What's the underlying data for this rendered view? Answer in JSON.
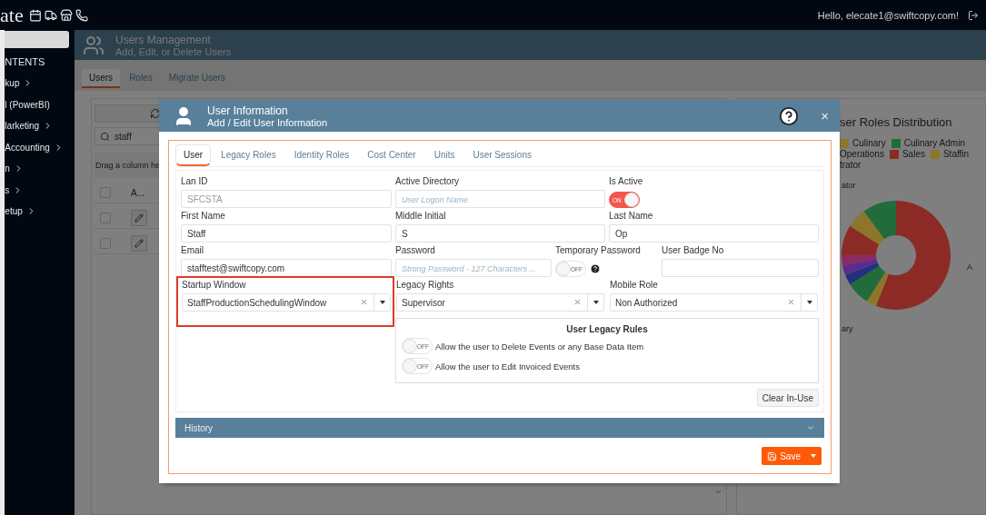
{
  "topbar": {
    "logo": "ate",
    "greeting": "Hello, elecate1@swiftcopy.com!"
  },
  "sidebar": {
    "section": "NTENTS",
    "items": [
      {
        "label": "kup",
        "expandable": true
      },
      {
        "label": "l (PowerBI)",
        "expandable": false
      },
      {
        "label": "larketing",
        "expandable": true
      },
      {
        "label": "Accounting",
        "expandable": true
      },
      {
        "label": "n",
        "expandable": true
      },
      {
        "label": "s",
        "expandable": true
      },
      {
        "label": "etup",
        "expandable": true
      }
    ]
  },
  "page_header": {
    "title": "Users Management",
    "subtitle": "Add, Edit, or Delete Users"
  },
  "tabs": [
    {
      "label": "Users",
      "selected": true
    },
    {
      "label": "Roles",
      "selected": false
    },
    {
      "label": "Migrate Users",
      "selected": false
    }
  ],
  "grid": {
    "search": "staff",
    "group_hint": "Drag a column he",
    "header_checked": false,
    "columns": [
      "A..."
    ],
    "rows": [
      {
        "checked": false
      },
      {
        "checked": false
      }
    ]
  },
  "chart_panel": {
    "title": "ser Roles Distribution",
    "legend": [
      {
        "label": "Culinary",
        "color": "#8c7629"
      },
      {
        "label": "Culinary Admin",
        "color": "#226b3a"
      },
      {
        "label": "Operations"
      },
      {
        "label": "Sales",
        "color": "#8c2b26"
      },
      {
        "label": "Staffin",
        "color": "#8c7629"
      },
      {
        "label": "trator"
      }
    ],
    "slice_labels": [
      "ator",
      "ary",
      "A"
    ]
  },
  "modal": {
    "title": "User Information",
    "subtitle": "Add / Edit User Information",
    "close": "×",
    "tabs": [
      {
        "label": "User",
        "selected": true
      },
      {
        "label": "Legacy Roles",
        "selected": false
      },
      {
        "label": "Identity Roles",
        "selected": false
      },
      {
        "label": "Cost Center",
        "selected": false
      },
      {
        "label": "Units",
        "selected": false
      },
      {
        "label": "User Sessions",
        "selected": false
      }
    ],
    "rows": [
      [
        {
          "kind": "text",
          "label": "Lan ID",
          "value": "SFCSTA",
          "disabled": true
        },
        {
          "kind": "text",
          "label": "Active Directory",
          "placeholder": "User Logon Name"
        },
        {
          "kind": "toggle",
          "label": "Is Active",
          "on": true,
          "text": "ON"
        }
      ],
      [
        {
          "kind": "text",
          "label": "First Name",
          "value": "Staff"
        },
        {
          "kind": "text",
          "label": "Middle Initial",
          "value": "S"
        },
        {
          "kind": "text",
          "label": "Last Name",
          "value": "Op"
        }
      ],
      [
        {
          "kind": "text",
          "label": "Email",
          "value": "stafftest@swiftcopy.com"
        },
        {
          "kind": "group",
          "items": [
            {
              "kind": "text",
              "label": "Password",
              "placeholder": "Strong Password - 127 Characters ..."
            },
            {
              "kind": "toggle",
              "label": "Temporary Password",
              "on": false,
              "text": "OFF",
              "help": true
            },
            {
              "kind": "text",
              "label": "User Badge No"
            }
          ]
        }
      ],
      [
        {
          "kind": "select",
          "label": "Startup Window",
          "value": "StaffProductionSchedulingWindow",
          "highlighted": true
        },
        {
          "kind": "select",
          "label": "Legacy Rights",
          "value": "Supervisor",
          "highlighted": false
        },
        {
          "kind": "select",
          "label": "Mobile Role",
          "value": "Non Authorized",
          "highlighted": false
        }
      ]
    ],
    "legacy_rules": {
      "title": "User Legacy Rules",
      "rules": [
        {
          "label": "Allow the user to Delete Events or any Base Data Item",
          "on": false,
          "text": "OFF"
        },
        {
          "label": "Allow the user to Edit Invoiced Events",
          "on": false,
          "text": "OFF"
        }
      ]
    },
    "clear_button": "Clear In-Use",
    "history": {
      "title": "History",
      "expanded": false
    },
    "save_button": "Save"
  }
}
